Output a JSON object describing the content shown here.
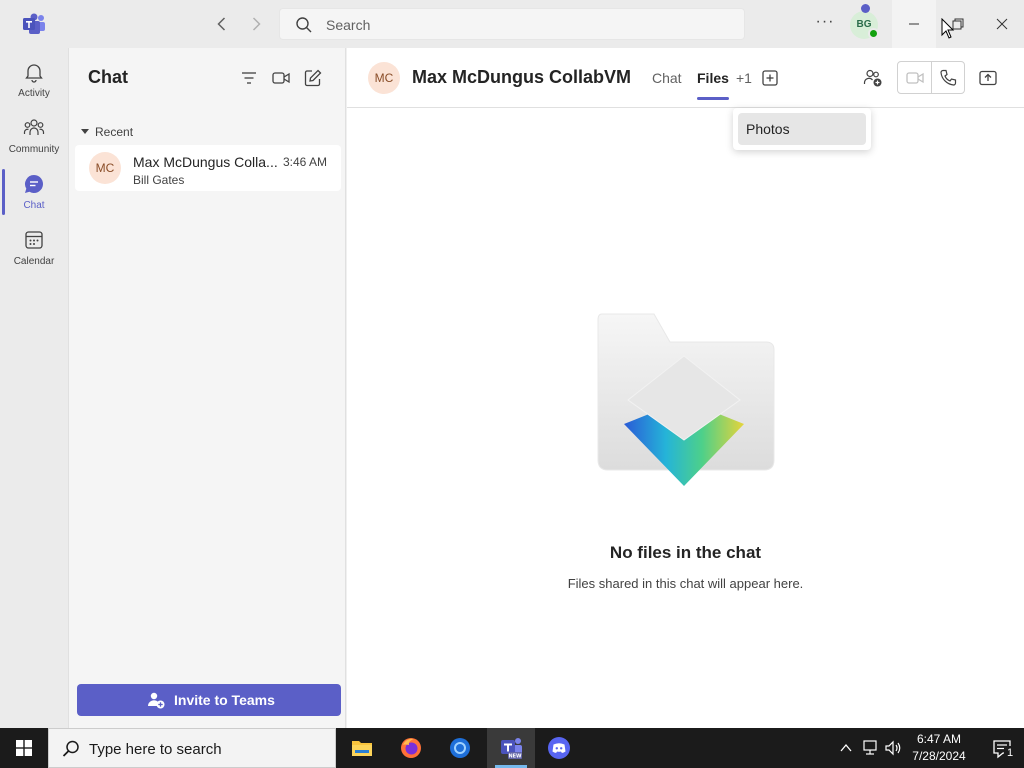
{
  "titlebar": {
    "search_placeholder": "Search",
    "user_initials": "BG",
    "more_label": "···"
  },
  "rail": {
    "items": [
      {
        "label": "Activity",
        "icon": "bell-icon"
      },
      {
        "label": "Community",
        "icon": "people-community-icon"
      },
      {
        "label": "Chat",
        "icon": "chat-bubble-icon",
        "active": true
      },
      {
        "label": "Calendar",
        "icon": "calendar-icon"
      }
    ]
  },
  "chat_panel": {
    "title": "Chat",
    "section_label": "Recent",
    "items": [
      {
        "initials": "MC",
        "name": "Max McDungus Colla...",
        "time": "3:46 AM",
        "preview": "Bill Gates"
      }
    ],
    "invite_label": "Invite to Teams"
  },
  "main": {
    "header": {
      "initials": "MC",
      "title": "Max McDungus CollabVM",
      "tabs": [
        {
          "label": "Chat",
          "active": false
        },
        {
          "label": "Files",
          "active": true
        },
        {
          "label": "+1",
          "active": false
        }
      ]
    },
    "dropdown": {
      "items": [
        "Photos"
      ]
    },
    "empty_state": {
      "title": "No files in the chat",
      "subtitle": "Files shared in this chat will appear here."
    }
  },
  "taskbar": {
    "search_placeholder": "Type here to search",
    "time": "6:47 AM",
    "date": "7/28/2024",
    "notification_count": "1"
  },
  "colors": {
    "accent": "#5b5fc7",
    "presence_available": "#13a10e"
  }
}
